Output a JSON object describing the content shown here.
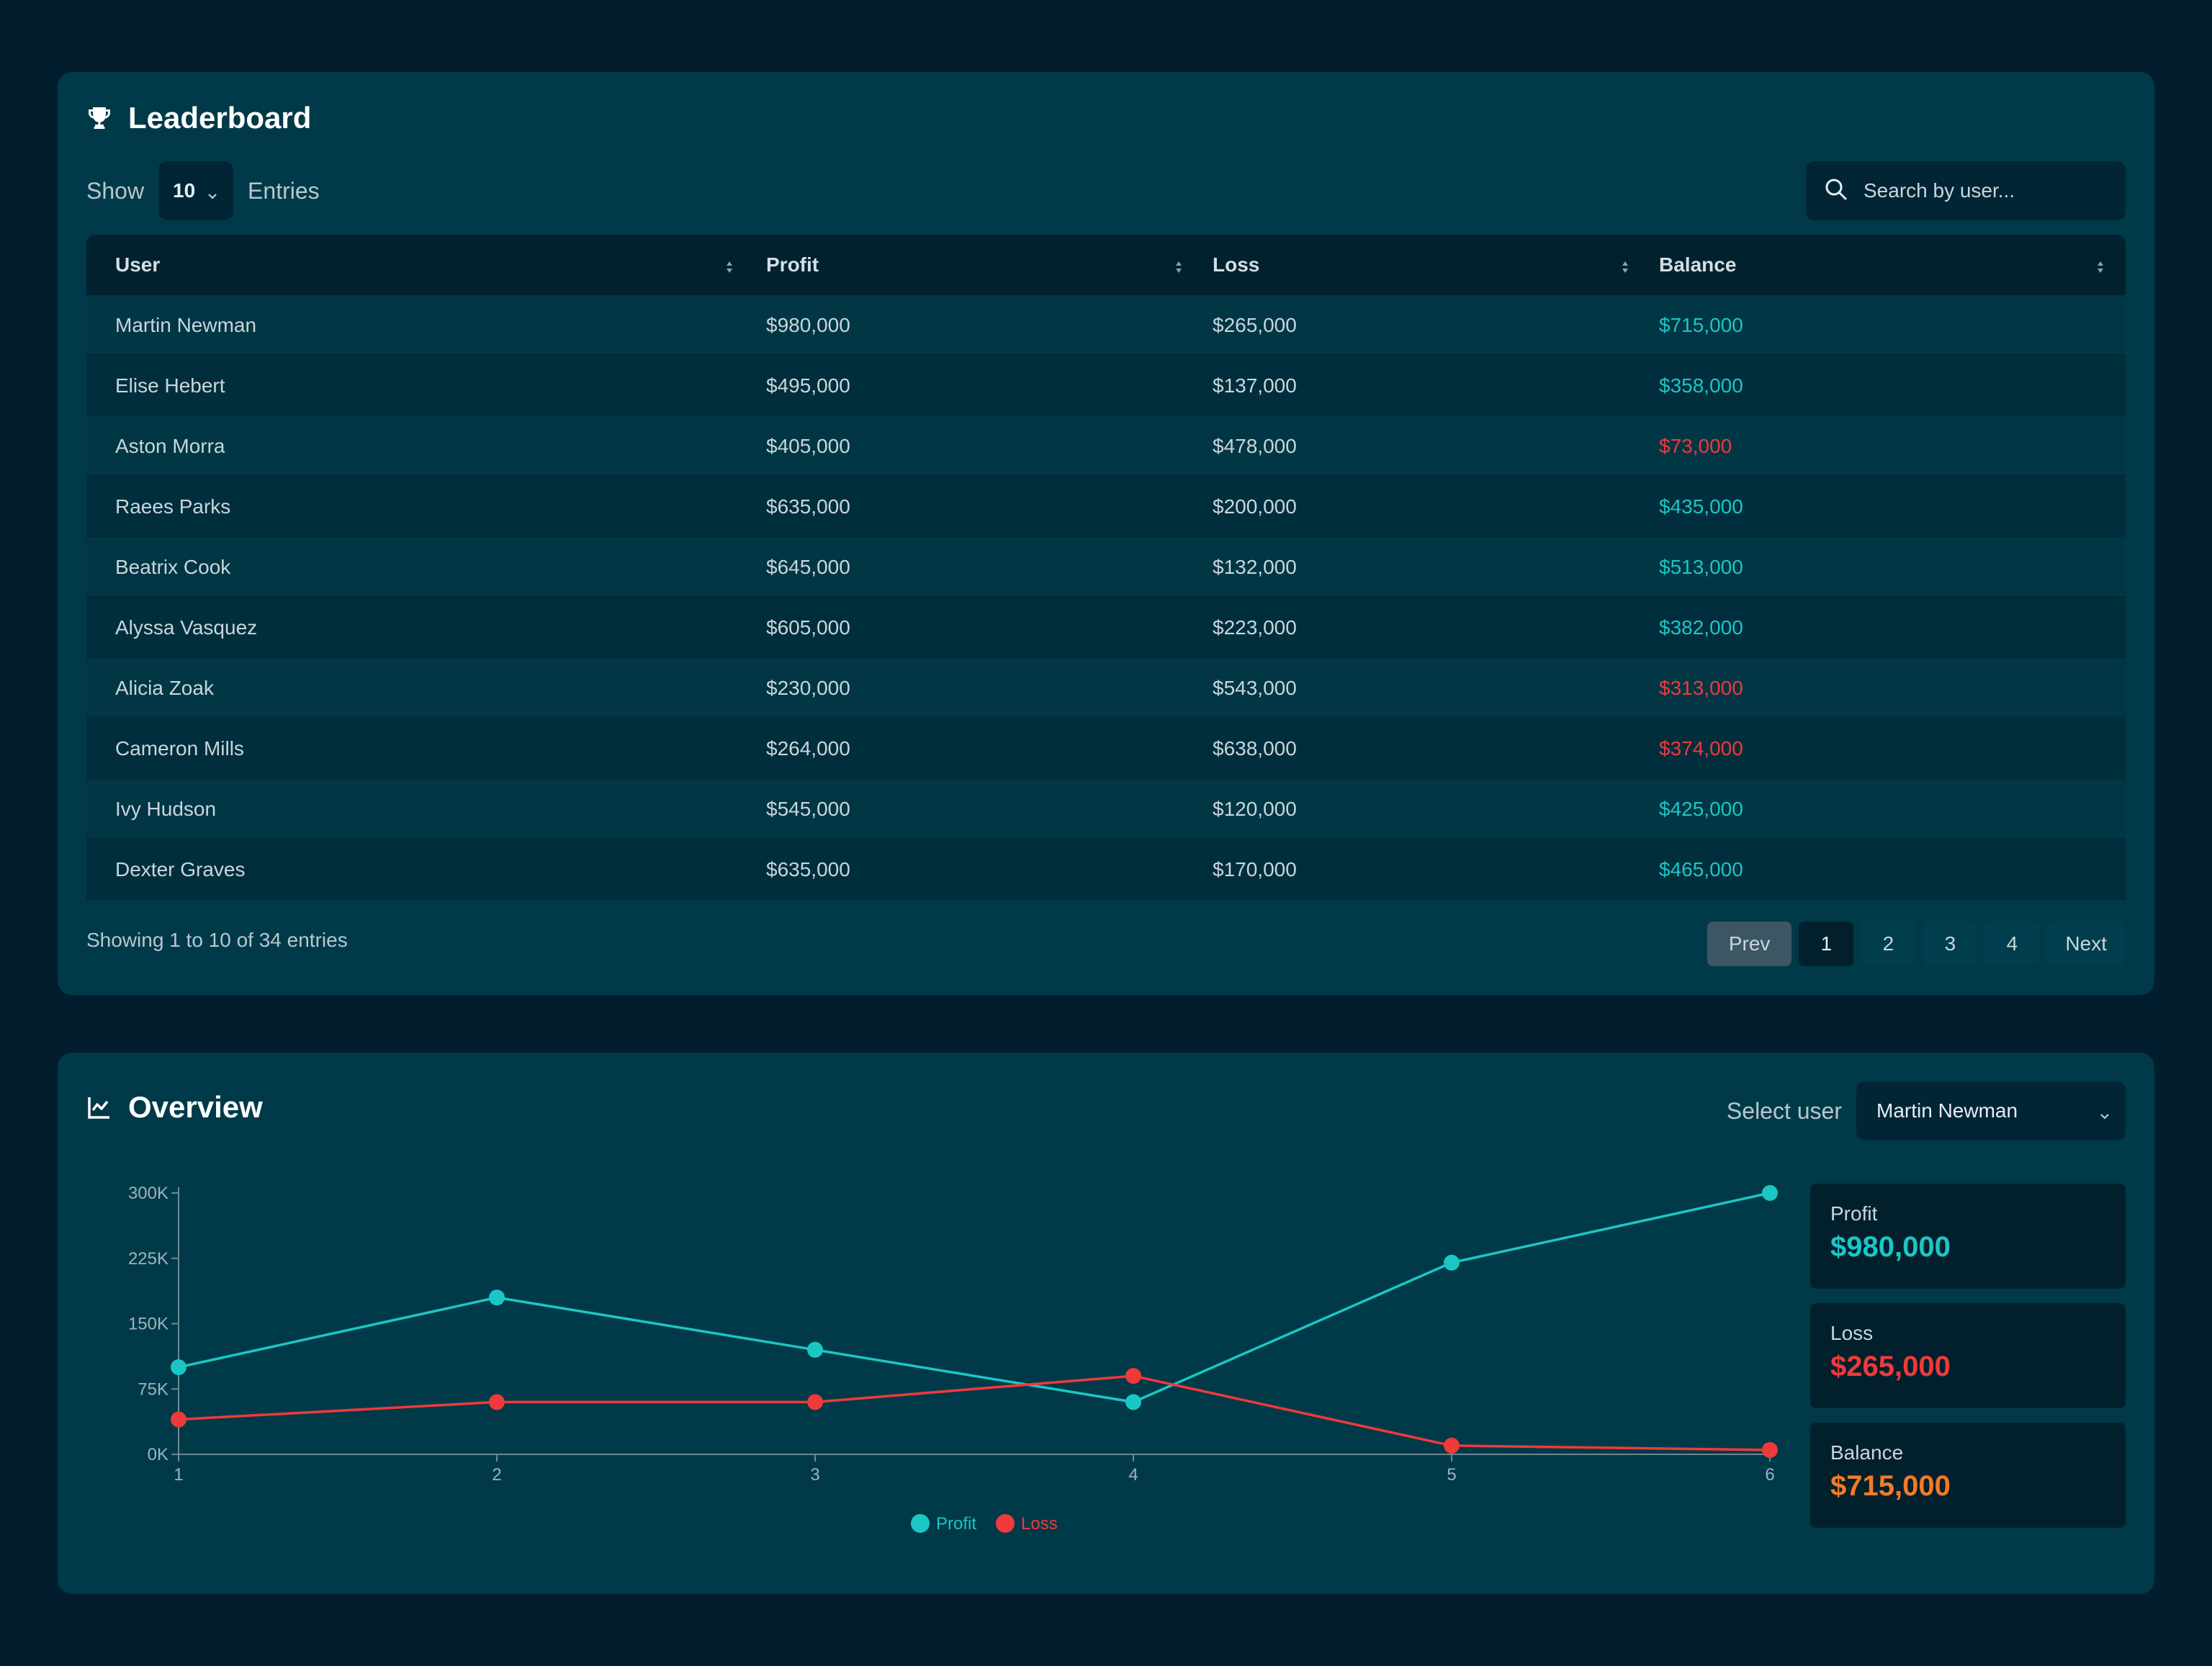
{
  "leaderboard": {
    "title": "Leaderboard",
    "show_label": "Show",
    "entries_value": "10",
    "entries_label": "Entries",
    "search_placeholder": "Search by user...",
    "columns": [
      "User",
      "Profit",
      "Loss",
      "Balance"
    ],
    "rows": [
      {
        "user": "Martin Newman",
        "profit": "$980,000",
        "loss": "$265,000",
        "balance": "$715,000",
        "status": "positive"
      },
      {
        "user": "Elise Hebert",
        "profit": "$495,000",
        "loss": "$137,000",
        "balance": "$358,000",
        "status": "positive"
      },
      {
        "user": "Aston Morra",
        "profit": "$405,000",
        "loss": "$478,000",
        "balance": "$73,000",
        "status": "negative"
      },
      {
        "user": "Raees Parks",
        "profit": "$635,000",
        "loss": "$200,000",
        "balance": "$435,000",
        "status": "positive"
      },
      {
        "user": "Beatrix Cook",
        "profit": "$645,000",
        "loss": "$132,000",
        "balance": "$513,000",
        "status": "positive"
      },
      {
        "user": "Alyssa Vasquez",
        "profit": "$605,000",
        "loss": "$223,000",
        "balance": "$382,000",
        "status": "positive"
      },
      {
        "user": "Alicia Zoak",
        "profit": "$230,000",
        "loss": "$543,000",
        "balance": "$313,000",
        "status": "negative"
      },
      {
        "user": "Cameron Mills",
        "profit": "$264,000",
        "loss": "$638,000",
        "balance": "$374,000",
        "status": "negative"
      },
      {
        "user": "Ivy Hudson",
        "profit": "$545,000",
        "loss": "$120,000",
        "balance": "$425,000",
        "status": "positive"
      },
      {
        "user": "Dexter Graves",
        "profit": "$635,000",
        "loss": "$170,000",
        "balance": "$465,000",
        "status": "positive"
      }
    ],
    "footer_text": "Showing 1 to 10 of 34 entries",
    "pagination": {
      "prev": "Prev",
      "pages": [
        "1",
        "2",
        "3",
        "4"
      ],
      "next": "Next",
      "current": "1"
    }
  },
  "overview": {
    "title": "Overview",
    "select_label": "Select user",
    "selected_user": "Martin Newman",
    "stats": [
      {
        "label": "Profit",
        "value": "$980,000",
        "color": "#1bc7c5"
      },
      {
        "label": "Loss",
        "value": "$265,000",
        "color": "#f0393a"
      },
      {
        "label": "Balance",
        "value": "$715,000",
        "color": "#f47a28"
      }
    ]
  },
  "colors": {
    "positive": "#1bc7c5",
    "negative": "#f0393a",
    "balance_accent": "#f47a28"
  },
  "chart_data": {
    "type": "line",
    "x": [
      1,
      2,
      3,
      4,
      5,
      6
    ],
    "ylim": [
      0,
      300000
    ],
    "yticks": [
      {
        "value": 0,
        "label": "0K"
      },
      {
        "value": 75000,
        "label": "75K"
      },
      {
        "value": 150000,
        "label": "150K"
      },
      {
        "value": 225000,
        "label": "225K"
      },
      {
        "value": 300000,
        "label": "300K"
      }
    ],
    "series": [
      {
        "name": "Profit",
        "color": "#1bc7c5",
        "values": [
          100000,
          180000,
          120000,
          60000,
          220000,
          300000
        ]
      },
      {
        "name": "Loss",
        "color": "#f0393a",
        "values": [
          40000,
          60000,
          60000,
          90000,
          10000,
          5000
        ]
      }
    ],
    "legend": "bottom-center",
    "grid": false
  }
}
